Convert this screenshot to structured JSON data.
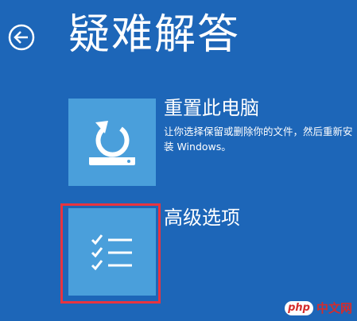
{
  "header": {
    "title": "疑难解答",
    "back_icon": "back-arrow-icon"
  },
  "options": [
    {
      "title": "重置此电脑",
      "description": "让你选择保留或删除你的文件，然后重新安装 Windows。",
      "icon": "reset-pc-icon"
    },
    {
      "title": "高级选项",
      "description": "",
      "icon": "checklist-icon"
    }
  ],
  "watermark": {
    "brand": "php",
    "text": "中文网"
  },
  "colors": {
    "background": "#1d66b8",
    "tile": "#4a9fdb",
    "highlight": "#e8343f"
  }
}
